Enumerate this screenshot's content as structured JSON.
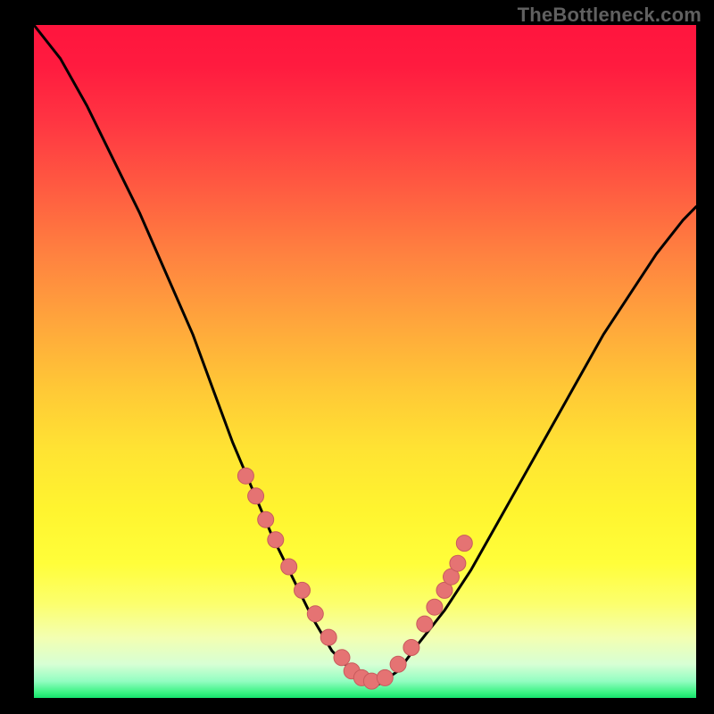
{
  "watermark": "TheBottleneck.com",
  "colors": {
    "curve": "#000000",
    "marker": "#e57373",
    "marker_stroke": "#c95b5d"
  },
  "chart_data": {
    "type": "line",
    "title": "",
    "xlabel": "",
    "ylabel": "",
    "xlim": [
      0,
      100
    ],
    "ylim": [
      0,
      100
    ],
    "grid": false,
    "legend": false,
    "series": [
      {
        "name": "bottleneck-curve",
        "x": [
          0,
          4,
          8,
          12,
          16,
          20,
          24,
          27,
          30,
          33,
          36,
          39,
          42,
          45,
          48,
          50,
          52,
          55,
          58,
          62,
          66,
          70,
          74,
          78,
          82,
          86,
          90,
          94,
          98,
          100
        ],
        "values": [
          100,
          95,
          88,
          80,
          72,
          63,
          54,
          46,
          38,
          31,
          24,
          18,
          12,
          7,
          4,
          2,
          2,
          4,
          8,
          13,
          19,
          26,
          33,
          40,
          47,
          54,
          60,
          66,
          71,
          73
        ]
      }
    ],
    "markers": {
      "name": "highlight-dots",
      "x": [
        32,
        33.5,
        35,
        36.5,
        38.5,
        40.5,
        42.5,
        44.5,
        46.5,
        48,
        49.5,
        51,
        53,
        55,
        57,
        59,
        60.5,
        62,
        63,
        64,
        65
      ],
      "values": [
        33,
        30,
        26.5,
        23.5,
        19.5,
        16,
        12.5,
        9,
        6,
        4,
        3,
        2.5,
        3,
        5,
        7.5,
        11,
        13.5,
        16,
        18,
        20,
        23
      ]
    }
  }
}
